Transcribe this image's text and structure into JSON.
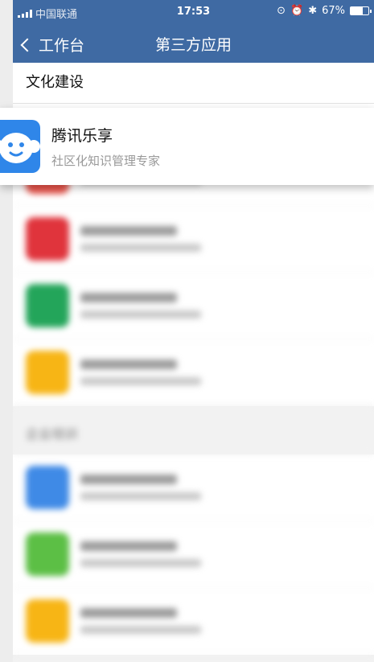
{
  "status_bar": {
    "carrier": "中国联通",
    "time": "17:53",
    "battery": "67%",
    "battery_level": 0.67
  },
  "nav": {
    "back_label": "工作台",
    "title": "第三方应用"
  },
  "section": {
    "title": "文化建设"
  },
  "highlight_app": {
    "name": "腾讯乐享",
    "description": "社区化知识管理专家",
    "icon": "monkey-face-icon",
    "color": "#2f86e9"
  },
  "blurred_apps": [
    {
      "color": "#e8534a"
    },
    {
      "color": "#e0343c"
    },
    {
      "color": "#23a55a"
    },
    {
      "color": "#f7b515"
    }
  ],
  "group2": {
    "title": "企业培训",
    "apps": [
      {
        "color": "#3f8ae6"
      },
      {
        "color": "#5cbf45"
      },
      {
        "color": "#f7b515"
      }
    ]
  }
}
